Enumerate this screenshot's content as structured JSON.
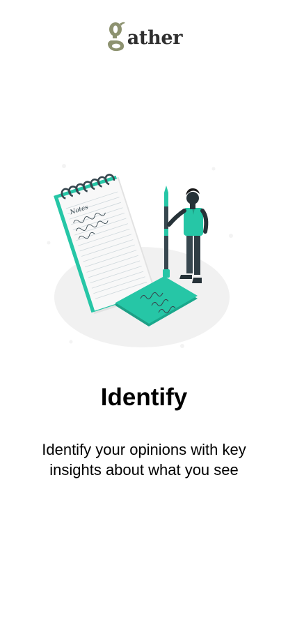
{
  "logo": {
    "text": "ather",
    "icon": "gather-g-logo"
  },
  "illustration": {
    "icon": "notes-and-person-illustration",
    "notepad_heading": "Notes"
  },
  "onboarding": {
    "title": "Identify",
    "description": "Identify your opinions with key insights about what you see"
  },
  "colors": {
    "accent": "#26C6A6",
    "logo_green": "#8d9270",
    "text": "#000000"
  }
}
